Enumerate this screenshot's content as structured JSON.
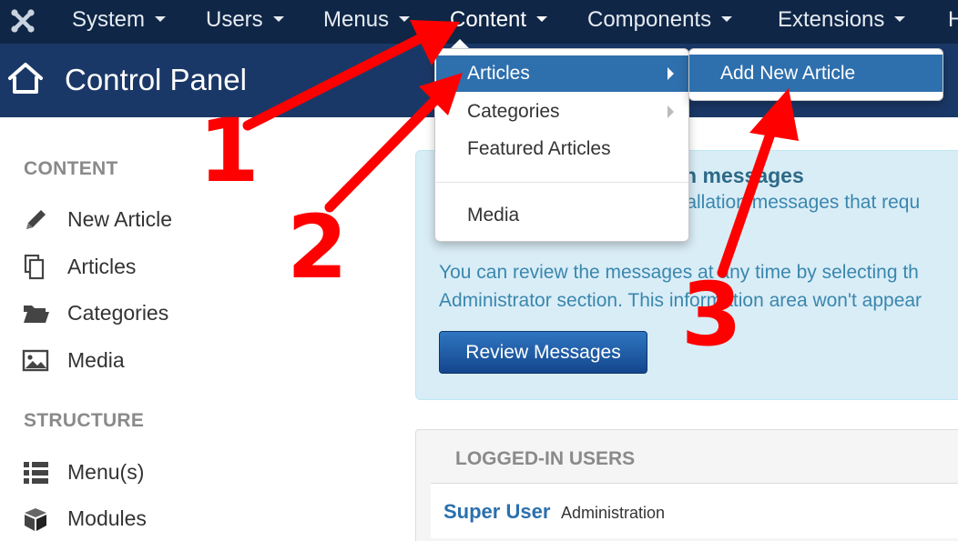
{
  "nav": {
    "items": [
      {
        "label": "System"
      },
      {
        "label": "Users"
      },
      {
        "label": "Menus"
      },
      {
        "label": "Content"
      },
      {
        "label": "Components"
      },
      {
        "label": "Extensions"
      },
      {
        "label": "H"
      }
    ],
    "active": "Content"
  },
  "header": {
    "title": "Control Panel",
    "icon": "home-icon"
  },
  "sidebar": {
    "content_heading": "CONTENT",
    "content_items": [
      {
        "label": "New Article",
        "icon": "pencil-icon"
      },
      {
        "label": "Articles",
        "icon": "copy-icon"
      },
      {
        "label": "Categories",
        "icon": "folder-open-icon"
      },
      {
        "label": "Media",
        "icon": "image-icon"
      }
    ],
    "structure_heading": "STRUCTURE",
    "structure_items": [
      {
        "label": "Menu(s)",
        "icon": "list-icon"
      },
      {
        "label": "Modules",
        "icon": "cube-icon"
      }
    ]
  },
  "dropdown": {
    "items": [
      {
        "label": "Articles",
        "submenu": true,
        "highlighted": true
      },
      {
        "label": "Categories",
        "submenu": true
      },
      {
        "label": "Featured Articles"
      },
      {
        "label": "Media"
      }
    ],
    "submenu_items": [
      {
        "label": "Add New Article",
        "highlighted": true
      }
    ]
  },
  "alert": {
    "title_fragment": "on messages",
    "line1_fragment": "stallation messages that requ",
    "paragraph_line1": "You can review the messages at any time by selecting th",
    "paragraph_line2": "Administrator section. This information area won't appear",
    "button_label": "Review Messages"
  },
  "logged_in_panel": {
    "heading": "LOGGED-IN USERS",
    "user_name": "Super User",
    "user_role": "Administration"
  },
  "annotations": {
    "step1": "1",
    "step2": "2",
    "step3": "3"
  },
  "colors": {
    "navbar": "#0f2646",
    "header": "#1a3867",
    "highlight": "#2e6fad",
    "alert_bg": "#d9edf7",
    "alert_text": "#3a87ad",
    "annotation": "#ff0000"
  }
}
